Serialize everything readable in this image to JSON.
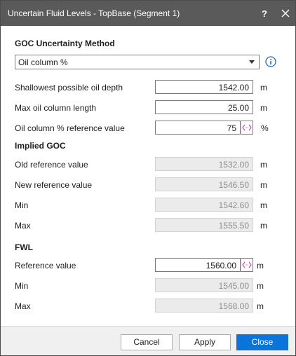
{
  "window": {
    "title": "Uncertain Fluid Levels - TopBase (Segment 1)",
    "help_glyph": "?",
    "close_icon": "close-icon"
  },
  "goc_method": {
    "heading": "GOC Uncertainty Method",
    "selected": "Oil column %",
    "info_icon": "info-icon"
  },
  "inputs": {
    "shallowest": {
      "label": "Shallowest possible oil depth",
      "value": "1542.00",
      "unit": "m"
    },
    "max_oil_column": {
      "label": "Max oil column length",
      "value": "25.00",
      "unit": "m"
    },
    "oil_column_pct": {
      "label": "Oil column % reference value",
      "value": "75",
      "unit": "%",
      "link_icon": "link-arrows-icon"
    }
  },
  "implied_goc": {
    "heading": "Implied GOC",
    "old_ref": {
      "label": "Old reference value",
      "value": "1532.00",
      "unit": "m"
    },
    "new_ref": {
      "label": "New reference value",
      "value": "1546.50",
      "unit": "m"
    },
    "min": {
      "label": "Min",
      "value": "1542.60",
      "unit": "m"
    },
    "max": {
      "label": "Max",
      "value": "1555.50",
      "unit": "m"
    }
  },
  "fwl": {
    "heading": "FWL",
    "ref": {
      "label": "Reference value",
      "value": "1560.00",
      "unit": "m",
      "link_icon": "link-arrows-icon"
    },
    "min": {
      "label": "Min",
      "value": "1545.00",
      "unit": "m"
    },
    "max": {
      "label": "Max",
      "value": "1568.00",
      "unit": "m"
    }
  },
  "buttons": {
    "cancel": "Cancel",
    "apply": "Apply",
    "close": "Close"
  },
  "colors": {
    "titlebar": "#5a5a5a",
    "primary": "#0a74da",
    "link_icon": "#c43dc4",
    "info_icon": "#1a6fc9"
  }
}
